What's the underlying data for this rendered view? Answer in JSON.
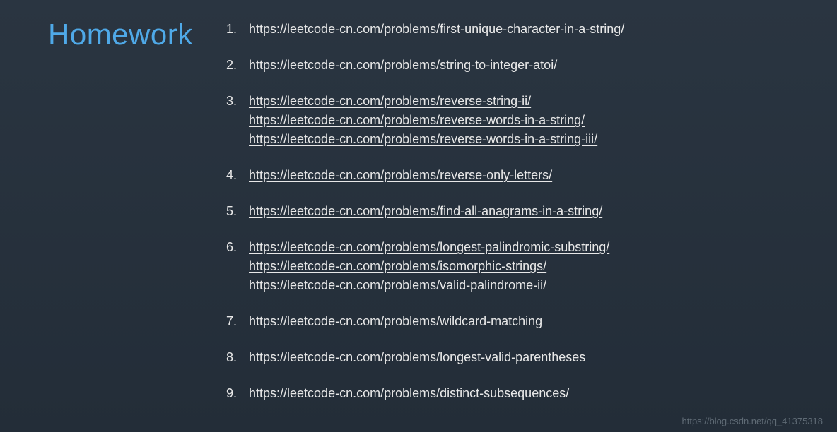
{
  "title": "Homework",
  "items": [
    {
      "number": "1.",
      "lines": [
        {
          "text": "https://leetcode-cn.com/problems/first-unique-character-in-a-string/",
          "underlined": false
        }
      ]
    },
    {
      "number": "2.",
      "lines": [
        {
          "text": "https://leetcode-cn.com/problems/string-to-integer-atoi/",
          "underlined": false
        }
      ]
    },
    {
      "number": "3.",
      "lines": [
        {
          "text": "https://leetcode-cn.com/problems/reverse-string-ii/",
          "underlined": true
        },
        {
          "text": "https://leetcode-cn.com/problems/reverse-words-in-a-string/",
          "underlined": true
        },
        {
          "text": "https://leetcode-cn.com/problems/reverse-words-in-a-string-iii/",
          "underlined": true
        }
      ]
    },
    {
      "number": "4.",
      "lines": [
        {
          "text": "https://leetcode-cn.com/problems/reverse-only-letters/",
          "underlined": true
        }
      ]
    },
    {
      "number": "5.",
      "lines": [
        {
          "text": "https://leetcode-cn.com/problems/find-all-anagrams-in-a-string/",
          "underlined": true
        }
      ]
    },
    {
      "number": "6.",
      "lines": [
        {
          "text": "https://leetcode-cn.com/problems/longest-palindromic-substring/",
          "underlined": true
        },
        {
          "text": "https://leetcode-cn.com/problems/isomorphic-strings/",
          "underlined": true
        },
        {
          "text": "https://leetcode-cn.com/problems/valid-palindrome-ii/",
          "underlined": true
        }
      ]
    },
    {
      "number": "7.",
      "lines": [
        {
          "text": "https://leetcode-cn.com/problems/wildcard-matching",
          "underlined": true
        }
      ]
    },
    {
      "number": "8.",
      "lines": [
        {
          "text": "https://leetcode-cn.com/problems/longest-valid-parentheses",
          "underlined": true
        }
      ]
    },
    {
      "number": "9.",
      "lines": [
        {
          "text": "https://leetcode-cn.com/problems/distinct-subsequences/",
          "underlined": true
        }
      ]
    }
  ],
  "watermark": "https://blog.csdn.net/qq_41375318"
}
